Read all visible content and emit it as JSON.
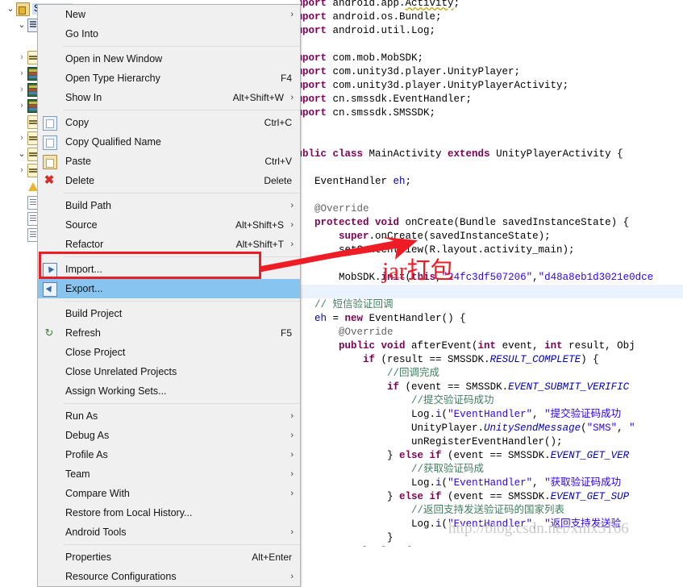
{
  "tree": {
    "items": [
      {
        "indent": 0,
        "arrow": "open",
        "icon": "project-icon",
        "label": "SMSTest",
        "selected": true
      },
      {
        "indent": 1,
        "arrow": "open",
        "icon": "source-folder-icon",
        "label": ""
      },
      {
        "indent": 2,
        "arrow": "none",
        "icon": "none",
        "label": ""
      },
      {
        "indent": 1,
        "arrow": "closed",
        "icon": "package-icon",
        "label": ""
      },
      {
        "indent": 1,
        "arrow": "closed",
        "icon": "library-icon",
        "label": ""
      },
      {
        "indent": 1,
        "arrow": "closed",
        "icon": "library-icon",
        "label": ""
      },
      {
        "indent": 1,
        "arrow": "closed",
        "icon": "library-icon",
        "label": ""
      },
      {
        "indent": 1,
        "arrow": "none",
        "icon": "package-icon",
        "label": ""
      },
      {
        "indent": 1,
        "arrow": "closed",
        "icon": "package-icon",
        "label": ""
      },
      {
        "indent": 1,
        "arrow": "open",
        "icon": "package-icon",
        "label": ""
      },
      {
        "indent": 1,
        "arrow": "closed",
        "icon": "package-icon",
        "label": ""
      },
      {
        "indent": 1,
        "arrow": "none",
        "icon": "warning-icon",
        "label": ""
      },
      {
        "indent": 1,
        "arrow": "none",
        "icon": "file-icon",
        "label": ""
      },
      {
        "indent": 1,
        "arrow": "none",
        "icon": "file-icon",
        "label": ""
      },
      {
        "indent": 1,
        "arrow": "none",
        "icon": "file-icon",
        "label": ""
      }
    ]
  },
  "menu": {
    "title": "project-context-menu",
    "entries": [
      {
        "type": "item",
        "name": "new",
        "label": "New",
        "accel": "",
        "submenu": true,
        "icon": "none"
      },
      {
        "type": "item",
        "name": "go-into",
        "label": "Go Into",
        "accel": "",
        "submenu": false,
        "icon": "none"
      },
      {
        "type": "sep"
      },
      {
        "type": "item",
        "name": "open-in-new-window",
        "label": "Open in New Window",
        "accel": "",
        "submenu": false,
        "icon": "none"
      },
      {
        "type": "item",
        "name": "open-type-hierarchy",
        "label": "Open Type Hierarchy",
        "accel": "F4",
        "submenu": false,
        "icon": "none"
      },
      {
        "type": "item",
        "name": "show-in",
        "label": "Show In",
        "accel": "Alt+Shift+W",
        "submenu": true,
        "icon": "none"
      },
      {
        "type": "sep"
      },
      {
        "type": "item",
        "name": "copy",
        "label": "Copy",
        "accel": "Ctrl+C",
        "submenu": false,
        "icon": "copy-icon"
      },
      {
        "type": "item",
        "name": "copy-qualified-name",
        "label": "Copy Qualified Name",
        "accel": "",
        "submenu": false,
        "icon": "copy-qualified-icon"
      },
      {
        "type": "item",
        "name": "paste",
        "label": "Paste",
        "accel": "Ctrl+V",
        "submenu": false,
        "icon": "paste-icon"
      },
      {
        "type": "item",
        "name": "delete",
        "label": "Delete",
        "accel": "Delete",
        "submenu": false,
        "icon": "delete-icon"
      },
      {
        "type": "sep"
      },
      {
        "type": "item",
        "name": "build-path",
        "label": "Build Path",
        "accel": "",
        "submenu": true,
        "icon": "none"
      },
      {
        "type": "item",
        "name": "source",
        "label": "Source",
        "accel": "Alt+Shift+S",
        "submenu": true,
        "icon": "none"
      },
      {
        "type": "item",
        "name": "refactor",
        "label": "Refactor",
        "accel": "Alt+Shift+T",
        "submenu": true,
        "icon": "none"
      },
      {
        "type": "sep"
      },
      {
        "type": "item",
        "name": "import",
        "label": "Import...",
        "accel": "",
        "submenu": false,
        "icon": "import-icon"
      },
      {
        "type": "item",
        "name": "export",
        "label": "Export...",
        "accel": "",
        "submenu": false,
        "icon": "export-icon",
        "selected": true
      },
      {
        "type": "sep"
      },
      {
        "type": "item",
        "name": "build-project",
        "label": "Build Project",
        "accel": "",
        "submenu": false,
        "icon": "none"
      },
      {
        "type": "item",
        "name": "refresh",
        "label": "Refresh",
        "accel": "F5",
        "submenu": false,
        "icon": "refresh-icon"
      },
      {
        "type": "item",
        "name": "close-project",
        "label": "Close Project",
        "accel": "",
        "submenu": false,
        "icon": "none"
      },
      {
        "type": "item",
        "name": "close-unrelated-projects",
        "label": "Close Unrelated Projects",
        "accel": "",
        "submenu": false,
        "icon": "none"
      },
      {
        "type": "item",
        "name": "assign-working-sets",
        "label": "Assign Working Sets...",
        "accel": "",
        "submenu": false,
        "icon": "none"
      },
      {
        "type": "sep"
      },
      {
        "type": "item",
        "name": "run-as",
        "label": "Run As",
        "accel": "",
        "submenu": true,
        "icon": "none"
      },
      {
        "type": "item",
        "name": "debug-as",
        "label": "Debug As",
        "accel": "",
        "submenu": true,
        "icon": "none"
      },
      {
        "type": "item",
        "name": "profile-as",
        "label": "Profile As",
        "accel": "",
        "submenu": true,
        "icon": "none"
      },
      {
        "type": "item",
        "name": "team",
        "label": "Team",
        "accel": "",
        "submenu": true,
        "icon": "none"
      },
      {
        "type": "item",
        "name": "compare-with",
        "label": "Compare With",
        "accel": "",
        "submenu": true,
        "icon": "none"
      },
      {
        "type": "item",
        "name": "restore-from-local-history",
        "label": "Restore from Local History...",
        "accel": "",
        "submenu": false,
        "icon": "none"
      },
      {
        "type": "item",
        "name": "android-tools",
        "label": "Android Tools",
        "accel": "",
        "submenu": true,
        "icon": "none"
      },
      {
        "type": "sep"
      },
      {
        "type": "item",
        "name": "properties",
        "label": "Properties",
        "accel": "Alt+Enter",
        "submenu": false,
        "icon": "none"
      },
      {
        "type": "item",
        "name": "resource-configurations",
        "label": "Resource Configurations",
        "accel": "",
        "submenu": true,
        "icon": "none"
      }
    ]
  },
  "editor": {
    "lines": [
      {
        "hl": false,
        "html": "<span class=\"kw\">import</span> android.app.<span class=\"err\">Activity</span>;"
      },
      {
        "hl": false,
        "html": "<span class=\"kw\">import</span> android.os.Bundle;"
      },
      {
        "hl": false,
        "html": "<span class=\"kw\">import</span> android.util.Log;"
      },
      {
        "hl": false,
        "html": ""
      },
      {
        "hl": false,
        "html": "<span class=\"kw\">import</span> com.mob.MobSDK;"
      },
      {
        "hl": false,
        "html": "<span class=\"kw\">import</span> com.unity3d.player.UnityPlayer;"
      },
      {
        "hl": false,
        "html": "<span class=\"kw\">import</span> com.unity3d.player.UnityPlayerActivity;"
      },
      {
        "hl": false,
        "html": "<span class=\"kw\">import</span> cn.smssdk.EventHandler;"
      },
      {
        "hl": false,
        "html": "<span class=\"kw\">import</span> cn.smssdk.SMSSDK;"
      },
      {
        "hl": false,
        "html": ""
      },
      {
        "hl": false,
        "html": ""
      },
      {
        "hl": false,
        "html": "<span class=\"kw\">public class</span> MainActivity <span class=\"kw\">extends</span> UnityPlayerActivity {"
      },
      {
        "hl": false,
        "html": ""
      },
      {
        "hl": false,
        "html": "    EventHandler <span class=\"fld\">eh</span>;"
      },
      {
        "hl": false,
        "html": ""
      },
      {
        "hl": false,
        "html": "    <span class=\"ann\">@Override</span>"
      },
      {
        "hl": false,
        "html": "    <span class=\"kw\">protected void</span> onCreate(Bundle savedInstanceState) {"
      },
      {
        "hl": false,
        "html": "        <span class=\"kw\">super</span>.onCreate(savedInstanceState);"
      },
      {
        "hl": false,
        "html": "        setContentView(R.layout.activity_main);"
      },
      {
        "hl": false,
        "html": ""
      },
      {
        "hl": false,
        "html": "        MobSDK.<span class=\"kw\">init</span>(<span class=\"kw\">this</span>,<span class=\"str\">\"24fc3df507206\"</span>,<span class=\"str\">\"d48a8eb1d3021e0dce</span>"
      },
      {
        "hl": true,
        "html": ""
      },
      {
        "hl": false,
        "html": "    <span class=\"cmt\">// 短信验证回调</span>"
      },
      {
        "hl": false,
        "html": "    <span class=\"fld\">eh</span> = <span class=\"kw\">new</span> EventHandler() {"
      },
      {
        "hl": false,
        "html": "        <span class=\"ann\">@Override</span>"
      },
      {
        "hl": false,
        "html": "        <span class=\"kw\">public void</span> afterEvent(<span class=\"kw\">int</span> event, <span class=\"kw\">int</span> result, Obj"
      },
      {
        "hl": false,
        "html": "            <span class=\"kw\">if</span> (result == SMSSDK.<span class=\"stat\">RESULT_COMPLETE</span>) {"
      },
      {
        "hl": false,
        "html": "                <span class=\"cmt\">//回调完成</span>"
      },
      {
        "hl": false,
        "html": "                <span class=\"kw\">if</span> (event == SMSSDK.<span class=\"stat\">EVENT_SUBMIT_VERIFIC</span>"
      },
      {
        "hl": false,
        "html": "                    <span class=\"cmt\">//提交验证码成功</span>"
      },
      {
        "hl": false,
        "html": "                    Log.<span class=\"fld\">i</span>(<span class=\"str\">\"EventHandler\"</span>, <span class=\"str\">\"提交验证码成功</span>"
      },
      {
        "hl": false,
        "html": "                    UnityPlayer.<span class=\"stat\">UnitySendMessage</span>(<span class=\"str\">\"SMS\"</span>, <span class=\"str\">\"</span>"
      },
      {
        "hl": false,
        "html": "                    unRegisterEventHandler();"
      },
      {
        "hl": false,
        "html": "                } <span class=\"kw\">else if</span> (event == SMSSDK.<span class=\"stat\">EVENT_GET_VER</span>"
      },
      {
        "hl": false,
        "html": "                    <span class=\"cmt\">//获取验证码成</span>"
      },
      {
        "hl": false,
        "html": "                    Log.<span class=\"fld\">i</span>(<span class=\"str\">\"EventHandler\"</span>, <span class=\"str\">\"获取验证码成功</span>"
      },
      {
        "hl": false,
        "html": "                } <span class=\"kw\">else if</span> (event == SMSSDK.<span class=\"stat\">EVENT_GET_SUP</span>"
      },
      {
        "hl": false,
        "html": "                    <span class=\"cmt\">//返回支持发送验证码的国家列表</span>"
      },
      {
        "hl": false,
        "html": "                    Log.<span class=\"fld\">i</span>(<span class=\"str\">\"EventHandler\"</span>, <span class=\"str\">\"返回支持发送验</span>"
      },
      {
        "hl": false,
        "html": "                }"
      },
      {
        "hl": false,
        "html": "            } <span class=\"kw\">else</span> {"
      }
    ]
  },
  "annotations": {
    "jar_label": "jar打包",
    "watermark": "http://blog.csdn.net/xmx5166",
    "red_color": "#ee1c25",
    "highlight_color": "#87c5f0"
  }
}
